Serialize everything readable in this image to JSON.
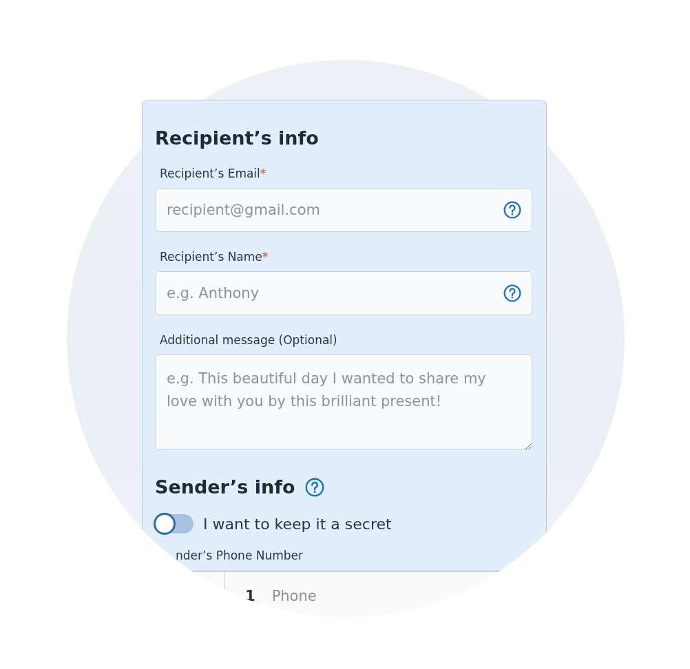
{
  "recipient_section": {
    "title": "Recipient’s info",
    "fields": [
      {
        "kind": "input",
        "label": "Recipient’s Email",
        "required_mark": "*",
        "placeholder": "recipient@gmail.com",
        "help": true
      },
      {
        "kind": "input",
        "label": "Recipient’s Name",
        "required_mark": "*",
        "placeholder": "e.g. Anthony",
        "help": true
      },
      {
        "kind": "textarea",
        "label": "Additional message (Optional)",
        "placeholder": "e.g. This beautiful day I wanted to share my love with you by this brilliant present!"
      }
    ]
  },
  "sender_section": {
    "title": "Sender’s info",
    "help": true,
    "secret_toggle": {
      "label": "I want to keep it a secret",
      "on": false
    },
    "phone": {
      "label": "nder’s Phone Number",
      "country_code": "1",
      "placeholder": "Phone"
    }
  }
}
